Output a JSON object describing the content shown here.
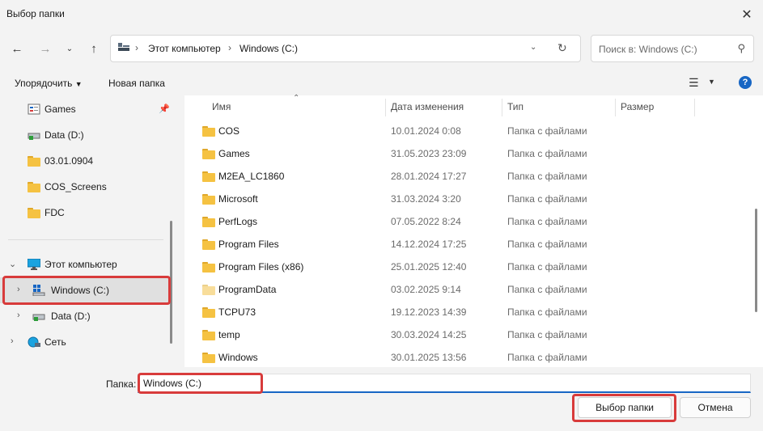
{
  "window": {
    "title": "Выбор папки"
  },
  "nav": {
    "address_parts": [
      "Этот компьютер",
      "Windows (C:)"
    ],
    "search_placeholder": "Поиск в: Windows (C:)"
  },
  "toolbar": {
    "organize": "Упорядочить",
    "new_folder": "Новая папка"
  },
  "sidebar": {
    "quick_access": [
      "Games",
      "Data (D:)",
      "03.01.0904",
      "COS_Screens",
      "FDC"
    ],
    "this_pc": "Этот компьютер",
    "drive_c": "Windows (C:)",
    "drive_d": "Data (D:)",
    "network": "Сеть"
  },
  "columns": {
    "name": "Имя",
    "date": "Дата изменения",
    "type": "Тип",
    "size": "Размер"
  },
  "rows": [
    {
      "name": "COS",
      "date": "10.01.2024 0:08",
      "type": "Папка с файлами"
    },
    {
      "name": "Games",
      "date": "31.05.2023 23:09",
      "type": "Папка с файлами"
    },
    {
      "name": "M2EA_LC1860",
      "date": "28.01.2024 17:27",
      "type": "Папка с файлами"
    },
    {
      "name": "Microsoft",
      "date": "31.03.2024 3:20",
      "type": "Папка с файлами"
    },
    {
      "name": "PerfLogs",
      "date": "07.05.2022 8:24",
      "type": "Папка с файлами"
    },
    {
      "name": "Program Files",
      "date": "14.12.2024 17:25",
      "type": "Папка с файлами"
    },
    {
      "name": "Program Files (x86)",
      "date": "25.01.2025 12:40",
      "type": "Папка с файлами"
    },
    {
      "name": "ProgramData",
      "date": "03.02.2025 9:14",
      "type": "Папка с файлами"
    },
    {
      "name": "TCPU73",
      "date": "19.12.2023 14:39",
      "type": "Папка с файлами"
    },
    {
      "name": "temp",
      "date": "30.03.2024 14:25",
      "type": "Папка с файлами"
    },
    {
      "name": "Windows",
      "date": "30.01.2025 13:56",
      "type": "Папка с файлами"
    }
  ],
  "footer": {
    "folder_label": "Папка:",
    "folder_value": "Windows (C:)",
    "select_button": "Выбор папки",
    "cancel_button": "Отмена"
  },
  "colors": {
    "folder": "#f5c242",
    "folder_tab": "#e0a82a",
    "folder_hidden": "#f8dd9a",
    "accent": "#1766c4",
    "highlight": "#d83b3b"
  }
}
